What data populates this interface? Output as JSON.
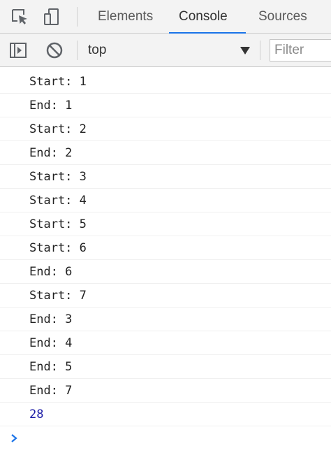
{
  "toolbar": {
    "inspect_icon": "inspect-element-icon",
    "device_icon": "device-toolbar-icon",
    "tabs": [
      {
        "label": "Elements",
        "active": false
      },
      {
        "label": "Console",
        "active": true
      },
      {
        "label": "Sources",
        "active": false
      }
    ],
    "active_color": "#1a73e8"
  },
  "console_toolbar": {
    "sidebar_icon": "show-console-sidebar-icon",
    "clear_icon": "clear-console-icon",
    "context": "top",
    "filter_placeholder": "Filter"
  },
  "console": {
    "logs": [
      "Start: 1",
      "End: 1",
      "Start: 2",
      "End: 2",
      "Start: 3",
      "Start: 4",
      "Start: 5",
      "Start: 6",
      "End: 6",
      "Start: 7",
      "End: 3",
      "End: 4",
      "End: 5",
      "End: 7"
    ],
    "result": "28",
    "result_color": "#1a1aa6",
    "prompt_icon": "prompt-chevron-icon",
    "prompt_color": "#1a73e8"
  }
}
